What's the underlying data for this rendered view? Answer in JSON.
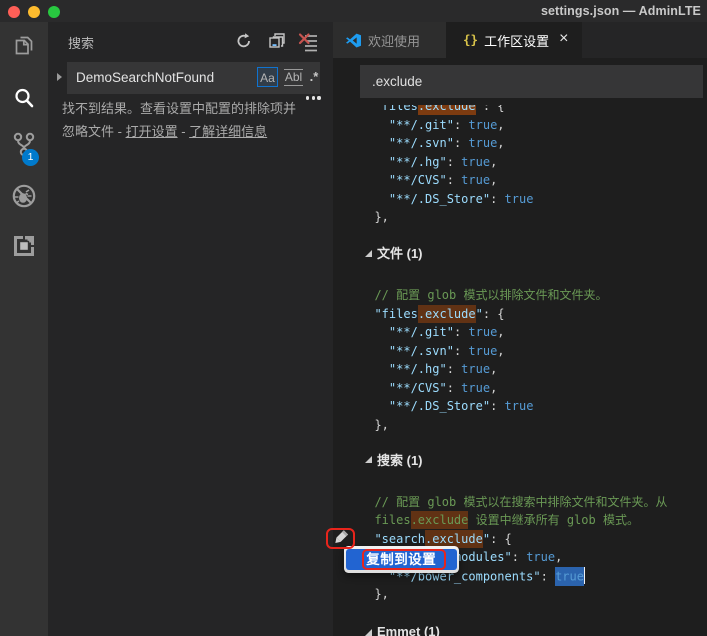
{
  "window": {
    "title": "settings.json — AdminLTE",
    "traffic_lights": [
      "close",
      "minimize",
      "zoom"
    ]
  },
  "activity_bar": {
    "items": [
      {
        "icon": "explorer-icon"
      },
      {
        "icon": "search-icon",
        "active": true
      },
      {
        "icon": "source-control-icon",
        "badge": "1"
      },
      {
        "icon": "debug-icon"
      },
      {
        "icon": "extensions-icon"
      }
    ]
  },
  "sidebar": {
    "title": "搜索",
    "actions": [
      {
        "icon": "refresh-icon"
      },
      {
        "icon": "collapse-all-icon"
      },
      {
        "icon": "clear-search-results-icon"
      }
    ],
    "search": {
      "value": "DemoSearchNotFound",
      "options": [
        {
          "label": "Aa",
          "name": "match-case",
          "active": true
        },
        {
          "label": "Abl",
          "name": "whole-word",
          "active": false
        },
        {
          "label": ".*",
          "name": "regex",
          "active": false
        }
      ]
    },
    "more_actions_icon": "ellipsis",
    "results": {
      "line1": "找不到结果。查看设置中配置的排除项并",
      "line2_prefix": "忽略文件 - ",
      "link_open_settings": "打开设置",
      "separator": " - ",
      "link_learn_more": "了解详细信息"
    }
  },
  "editor": {
    "tabs": [
      {
        "label": "欢迎使用",
        "icon": "vscode-logo-icon",
        "active": false
      },
      {
        "label": "工作区设置",
        "icon": "braces-icon",
        "active": true,
        "close": "×"
      }
    ],
    "settings_search": {
      "value": ".exclude"
    },
    "code_lines": [
      {
        "kind": "code",
        "segs": [
          {
            "c": "punct",
            "t": "  "
          },
          {
            "c": "key",
            "t": "\"files"
          },
          {
            "c": "key",
            "t": ".exclude",
            "m": 2
          },
          {
            "c": "key",
            "t": "\""
          },
          {
            "c": "punct",
            "t": ": {"
          }
        ]
      },
      {
        "kind": "code",
        "segs": [
          {
            "c": "punct",
            "t": "    "
          },
          {
            "c": "key",
            "t": "\"**/.git\""
          },
          {
            "c": "punct",
            "t": ": "
          },
          {
            "c": "bool",
            "t": "true"
          },
          {
            "c": "punct",
            "t": ","
          }
        ]
      },
      {
        "kind": "code",
        "segs": [
          {
            "c": "punct",
            "t": "    "
          },
          {
            "c": "key",
            "t": "\"**/.svn\""
          },
          {
            "c": "punct",
            "t": ": "
          },
          {
            "c": "bool",
            "t": "true"
          },
          {
            "c": "punct",
            "t": ","
          }
        ]
      },
      {
        "kind": "code",
        "segs": [
          {
            "c": "punct",
            "t": "    "
          },
          {
            "c": "key",
            "t": "\"**/.hg\""
          },
          {
            "c": "punct",
            "t": ": "
          },
          {
            "c": "bool",
            "t": "true"
          },
          {
            "c": "punct",
            "t": ","
          }
        ]
      },
      {
        "kind": "code",
        "segs": [
          {
            "c": "punct",
            "t": "    "
          },
          {
            "c": "key",
            "t": "\"**/CVS\""
          },
          {
            "c": "punct",
            "t": ": "
          },
          {
            "c": "bool",
            "t": "true"
          },
          {
            "c": "punct",
            "t": ","
          }
        ]
      },
      {
        "kind": "code",
        "segs": [
          {
            "c": "punct",
            "t": "    "
          },
          {
            "c": "key",
            "t": "\"**/.DS_Store\""
          },
          {
            "c": "punct",
            "t": ": "
          },
          {
            "c": "bool",
            "t": "true"
          }
        ]
      },
      {
        "kind": "code",
        "segs": [
          {
            "c": "punct",
            "t": "  },"
          }
        ]
      },
      {
        "kind": "header",
        "text": "文件 (1)"
      },
      {
        "kind": "code",
        "segs": [
          {
            "c": "comment",
            "t": "  // 配置 glob 模式以排除文件和文件夹。"
          }
        ]
      },
      {
        "kind": "code",
        "segs": [
          {
            "c": "punct",
            "t": "  "
          },
          {
            "c": "key",
            "t": "\"files"
          },
          {
            "c": "key",
            "t": ".exclude",
            "m": 1
          },
          {
            "c": "key",
            "t": "\""
          },
          {
            "c": "punct",
            "t": ": {"
          }
        ]
      },
      {
        "kind": "code",
        "segs": [
          {
            "c": "punct",
            "t": "    "
          },
          {
            "c": "key",
            "t": "\"**/.git\""
          },
          {
            "c": "punct",
            "t": ": "
          },
          {
            "c": "bool",
            "t": "true"
          },
          {
            "c": "punct",
            "t": ","
          }
        ]
      },
      {
        "kind": "code",
        "segs": [
          {
            "c": "punct",
            "t": "    "
          },
          {
            "c": "key",
            "t": "\"**/.svn\""
          },
          {
            "c": "punct",
            "t": ": "
          },
          {
            "c": "bool",
            "t": "true"
          },
          {
            "c": "punct",
            "t": ","
          }
        ]
      },
      {
        "kind": "code",
        "segs": [
          {
            "c": "punct",
            "t": "    "
          },
          {
            "c": "key",
            "t": "\"**/.hg\""
          },
          {
            "c": "punct",
            "t": ": "
          },
          {
            "c": "bool",
            "t": "true"
          },
          {
            "c": "punct",
            "t": ","
          }
        ]
      },
      {
        "kind": "code",
        "segs": [
          {
            "c": "punct",
            "t": "    "
          },
          {
            "c": "key",
            "t": "\"**/CVS\""
          },
          {
            "c": "punct",
            "t": ": "
          },
          {
            "c": "bool",
            "t": "true"
          },
          {
            "c": "punct",
            "t": ","
          }
        ]
      },
      {
        "kind": "code",
        "segs": [
          {
            "c": "punct",
            "t": "    "
          },
          {
            "c": "key",
            "t": "\"**/.DS_Store\""
          },
          {
            "c": "punct",
            "t": ": "
          },
          {
            "c": "bool",
            "t": "true"
          }
        ]
      },
      {
        "kind": "code",
        "segs": [
          {
            "c": "punct",
            "t": "  },"
          }
        ]
      },
      {
        "kind": "header",
        "text": "搜索 (1)"
      },
      {
        "kind": "code",
        "segs": [
          {
            "c": "comment",
            "t": "  // 配置 glob 模式以在搜索中排除文件和文件夹。从"
          }
        ]
      },
      {
        "kind": "code",
        "segs": [
          {
            "c": "comment",
            "t": "  files"
          },
          {
            "c": "comment",
            "t": ".exclude",
            "m": 1
          },
          {
            "c": "comment",
            "t": " 设置中继承所有 glob 模式。"
          }
        ]
      },
      {
        "kind": "code",
        "segs": [
          {
            "c": "punct",
            "t": "  "
          },
          {
            "c": "key",
            "t": "\"search"
          },
          {
            "c": "key",
            "t": ".exclude",
            "m": 1
          },
          {
            "c": "key",
            "t": "\""
          },
          {
            "c": "punct",
            "t": ": {"
          }
        ]
      },
      {
        "kind": "code",
        "segs": [
          {
            "c": "punct",
            "t": "    "
          },
          {
            "c": "key",
            "t": "\"**/node_modules\""
          },
          {
            "c": "punct",
            "t": ": "
          },
          {
            "c": "bool",
            "t": "true"
          },
          {
            "c": "punct",
            "t": ","
          }
        ]
      },
      {
        "kind": "code",
        "segs": [
          {
            "c": "punct",
            "t": "    "
          },
          {
            "c": "key",
            "t": "\"**/bower_components\""
          },
          {
            "c": "punct",
            "t": ": "
          },
          {
            "c": "bool",
            "t": "true",
            "s": 1
          },
          {
            "cursor": 1
          }
        ]
      },
      {
        "kind": "code",
        "segs": [
          {
            "c": "punct",
            "t": "  },"
          }
        ]
      },
      {
        "kind": "header",
        "text": "Emmet (1)"
      }
    ],
    "edit_icon": "pencil-icon",
    "context_menu": {
      "items": [
        {
          "label": "复制到设置",
          "highlighted": true
        }
      ]
    }
  },
  "annotations": [
    {
      "target": "pencil-icon",
      "shape": "red-rounded-rect"
    },
    {
      "target": "menu-item-copy-to-settings",
      "shape": "red-rounded-rect"
    }
  ],
  "colors": {
    "accent": "#007acc",
    "badge": "#007acc",
    "match_highlight": "#613214",
    "current_match_highlight": "#7d3b10",
    "selection": "#2b63ad",
    "menu_highlight": "#2264d1",
    "annotation_red": "#e8251c",
    "option_active_border": "#1073cf"
  }
}
